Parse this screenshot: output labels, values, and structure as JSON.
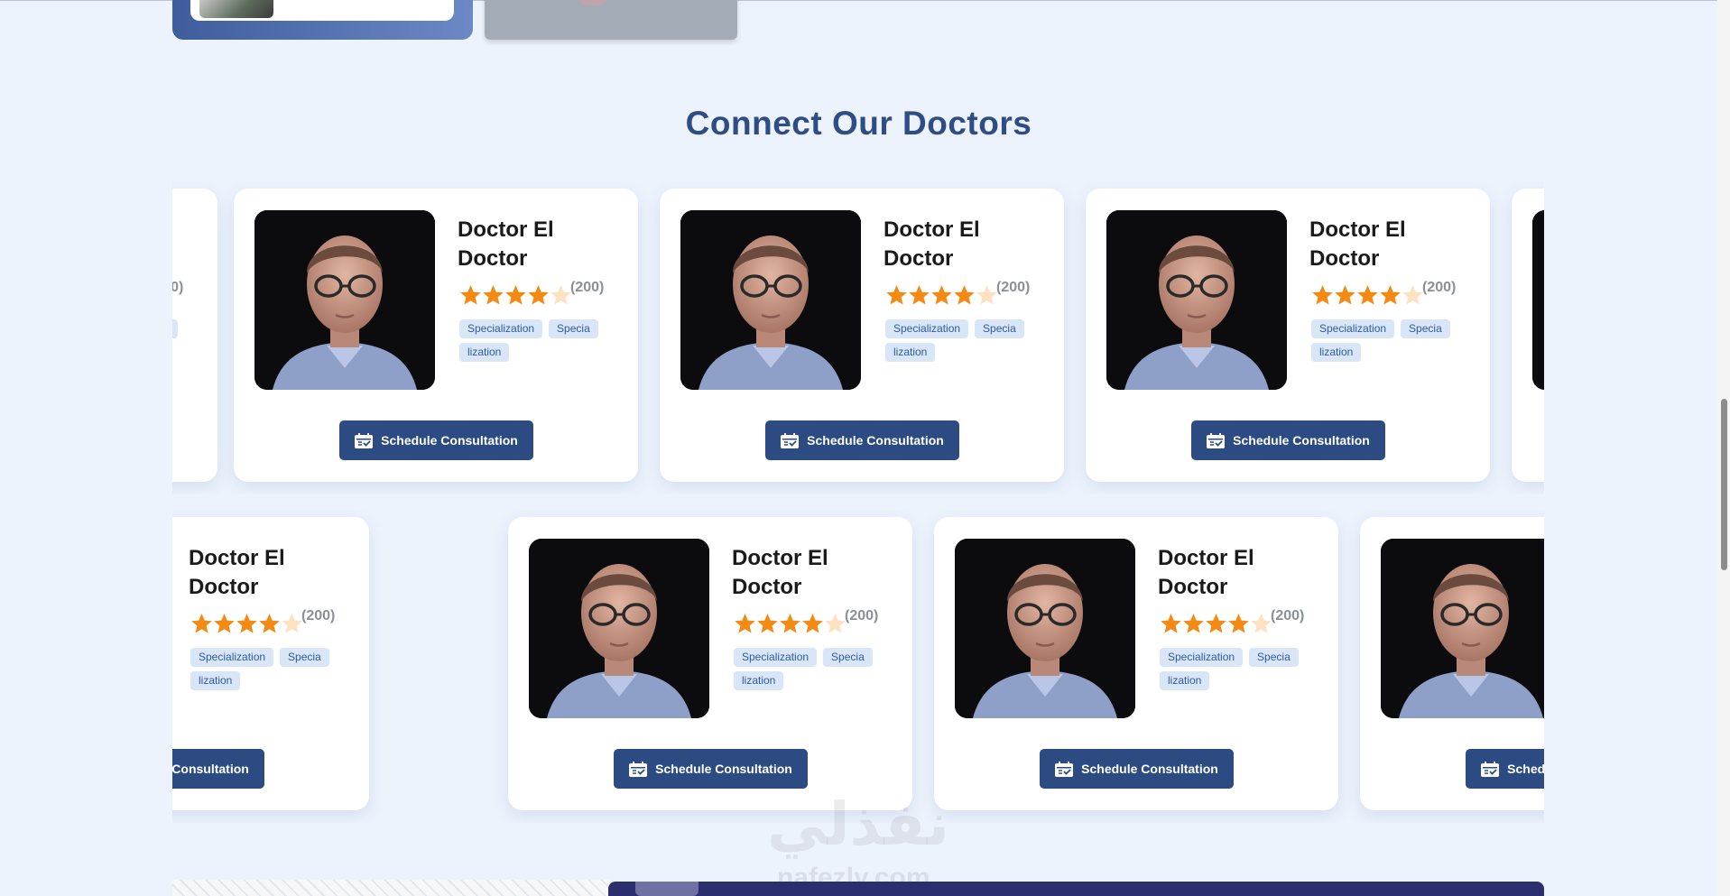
{
  "section": {
    "title": "Connect Our Doctors"
  },
  "doctor_card": {
    "name": "Doctor El Doctor",
    "rating": 4,
    "rating_max": 5,
    "review_count": "(200)",
    "tags": [
      "Specialization",
      "Specia",
      "lization"
    ],
    "button_label": "Schedule Consultation"
  },
  "colors": {
    "accent": "#2d4b83",
    "star": "#f28a14",
    "star_empty": "#fde1c0",
    "tag_bg": "#d9e6f8"
  },
  "icons": {
    "stars": "star-icon",
    "button": "calendar-check-icon"
  },
  "watermark": {
    "arabic": "نفذلي",
    "latin": "nafezly.com"
  }
}
